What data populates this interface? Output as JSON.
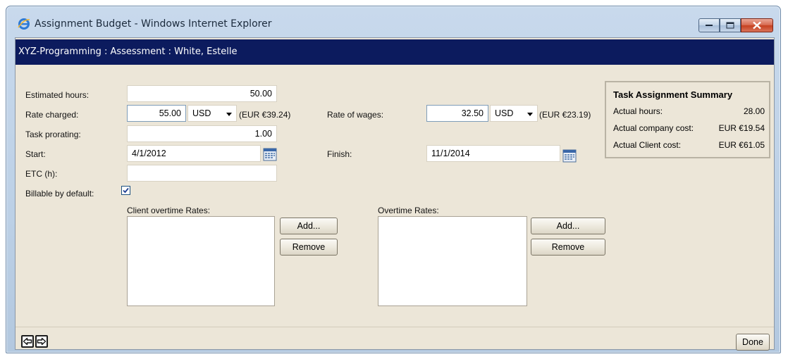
{
  "window": {
    "title": "Assignment Budget - Windows Internet Explorer"
  },
  "header": {
    "breadcrumb": "XYZ-Programming : Assessment : White, Estelle"
  },
  "form": {
    "estimated_hours": {
      "label": "Estimated hours:",
      "value": "50.00"
    },
    "rate_charged": {
      "label": "Rate charged:",
      "value": "55.00",
      "currency": "USD",
      "eur": "(EUR €39.24)"
    },
    "rate_of_wages": {
      "label": "Rate of wages:",
      "value": "32.50",
      "currency": "USD",
      "eur": "(EUR €23.19)"
    },
    "task_prorating": {
      "label": "Task prorating:",
      "value": "1.00"
    },
    "start": {
      "label": "Start:",
      "value": "4/1/2012"
    },
    "finish": {
      "label": "Finish:",
      "value": "11/1/2014"
    },
    "etc": {
      "label": "ETC (h):",
      "value": ""
    },
    "billable": {
      "label": "Billable by default:",
      "checked": true
    }
  },
  "client_overtime": {
    "label": "Client overtime Rates:",
    "add": "Add...",
    "remove": "Remove"
  },
  "overtime": {
    "label": "Overtime Rates:",
    "add": "Add...",
    "remove": "Remove"
  },
  "summary": {
    "title": "Task Assignment Summary",
    "rows": [
      {
        "label": "Actual hours:",
        "value": "28.00"
      },
      {
        "label": "Actual company cost:",
        "value": "EUR €19.54"
      },
      {
        "label": "Actual Client cost:",
        "value": "EUR €61.05"
      }
    ]
  },
  "footer": {
    "done": "Done"
  },
  "icons": {
    "ie": "internet-explorer-icon",
    "calendar": "calendar-icon",
    "back": "arrow-left-icon",
    "forward": "arrow-right-icon"
  },
  "colors": {
    "header_bg": "#0c1b5e",
    "panel_bg": "#ece6d8",
    "close_button": "#c5401f"
  }
}
